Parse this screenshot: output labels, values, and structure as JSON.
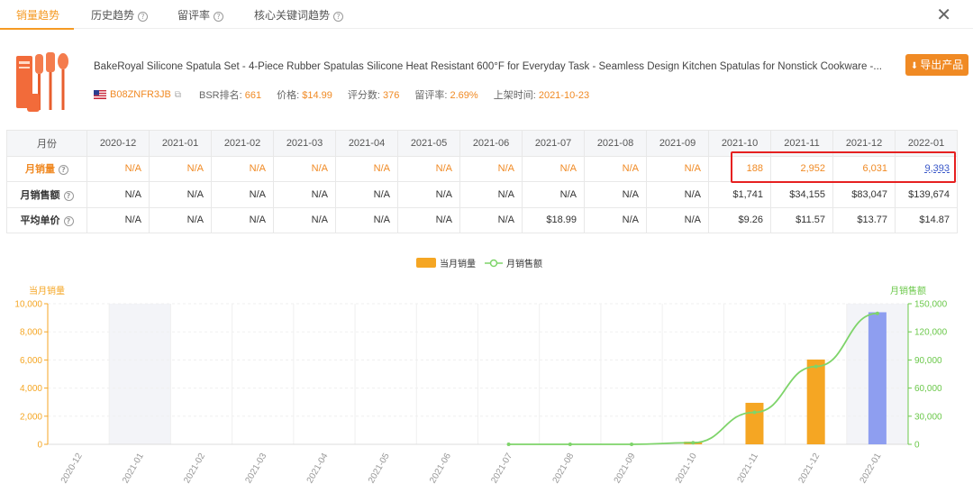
{
  "tabs": [
    {
      "label": "销量趋势",
      "active": true,
      "help": false
    },
    {
      "label": "历史趋势",
      "active": false,
      "help": true
    },
    {
      "label": "留评率",
      "active": false,
      "help": true
    },
    {
      "label": "核心关键词趋势",
      "active": false,
      "help": true
    }
  ],
  "close_icon": "✕",
  "product": {
    "title": "BakeRoyal Silicone Spatula Set - 4-Piece Rubber Spatulas Silicone Heat Resistant 600°F for Everyday Task - Seamless Design Kitchen Spatulas for Nonstick Cookware -...",
    "asin": "B08ZNFR3JB",
    "bsr_label": "BSR排名:",
    "bsr_value": "661",
    "price_label": "价格:",
    "price_value": "$14.99",
    "reviews_label": "评分数:",
    "reviews_value": "376",
    "review_rate_label": "留评率:",
    "review_rate_value": "2.69%",
    "launch_label": "上架时间:",
    "launch_value": "2021-10-23",
    "export_label": "导出产品"
  },
  "table": {
    "header_label": "月份",
    "months": [
      "2020-12",
      "2021-01",
      "2021-02",
      "2021-03",
      "2021-04",
      "2021-05",
      "2021-06",
      "2021-07",
      "2021-08",
      "2021-09",
      "2021-10",
      "2021-11",
      "2021-12",
      "2022-01"
    ],
    "rows": [
      {
        "label": "月销量",
        "help": true,
        "values": [
          "N/A",
          "N/A",
          "N/A",
          "N/A",
          "N/A",
          "N/A",
          "N/A",
          "N/A",
          "N/A",
          "N/A",
          "188",
          "2,952",
          "6,031",
          "9,393"
        ]
      },
      {
        "label": "月销售额",
        "help": true,
        "values": [
          "N/A",
          "N/A",
          "N/A",
          "N/A",
          "N/A",
          "N/A",
          "N/A",
          "N/A",
          "N/A",
          "N/A",
          "$1,741",
          "$34,155",
          "$83,047",
          "$139,674"
        ]
      },
      {
        "label": "平均单价",
        "help": true,
        "values": [
          "N/A",
          "N/A",
          "N/A",
          "N/A",
          "N/A",
          "N/A",
          "N/A",
          "$18.99",
          "N/A",
          "N/A",
          "$9.26",
          "$11.57",
          "$13.77",
          "$14.87"
        ]
      }
    ]
  },
  "chart": {
    "legend_bar": "当月销量",
    "legend_line": "月销售额",
    "left_axis_title": "当月销量",
    "right_axis_title": "月销售额"
  },
  "chart_data": {
    "type": "bar",
    "categories": [
      "2020-12",
      "2021-01",
      "2021-02",
      "2021-03",
      "2021-04",
      "2021-05",
      "2021-06",
      "2021-07",
      "2021-08",
      "2021-09",
      "2021-10",
      "2021-11",
      "2021-12",
      "2022-01"
    ],
    "series": [
      {
        "name": "当月销量",
        "type": "bar",
        "axis": "left",
        "values": [
          null,
          null,
          null,
          null,
          null,
          null,
          null,
          null,
          null,
          null,
          188,
          2952,
          6031,
          9393
        ]
      },
      {
        "name": "月销售额",
        "type": "line",
        "axis": "right",
        "values": [
          null,
          null,
          null,
          null,
          null,
          null,
          null,
          0,
          0,
          0,
          1741,
          34155,
          83047,
          139674
        ]
      }
    ],
    "ylim_left": [
      0,
      10000
    ],
    "yticks_left": [
      0,
      2000,
      4000,
      6000,
      8000,
      10000
    ],
    "ylim_right": [
      0,
      150000
    ],
    "yticks_right": [
      0,
      30000,
      60000,
      90000,
      120000,
      150000
    ],
    "highlighted_categories": [
      "2021-01",
      "2022-01"
    ],
    "grid": true,
    "legend": "top-center",
    "colors": {
      "bar": "#f5a623",
      "bar_highlight": "#8e9ef0",
      "line": "#7ed46a",
      "left_axis": "#f5a623",
      "right_axis": "#6bc84a",
      "highlight_band": "#f3f4f8"
    }
  }
}
